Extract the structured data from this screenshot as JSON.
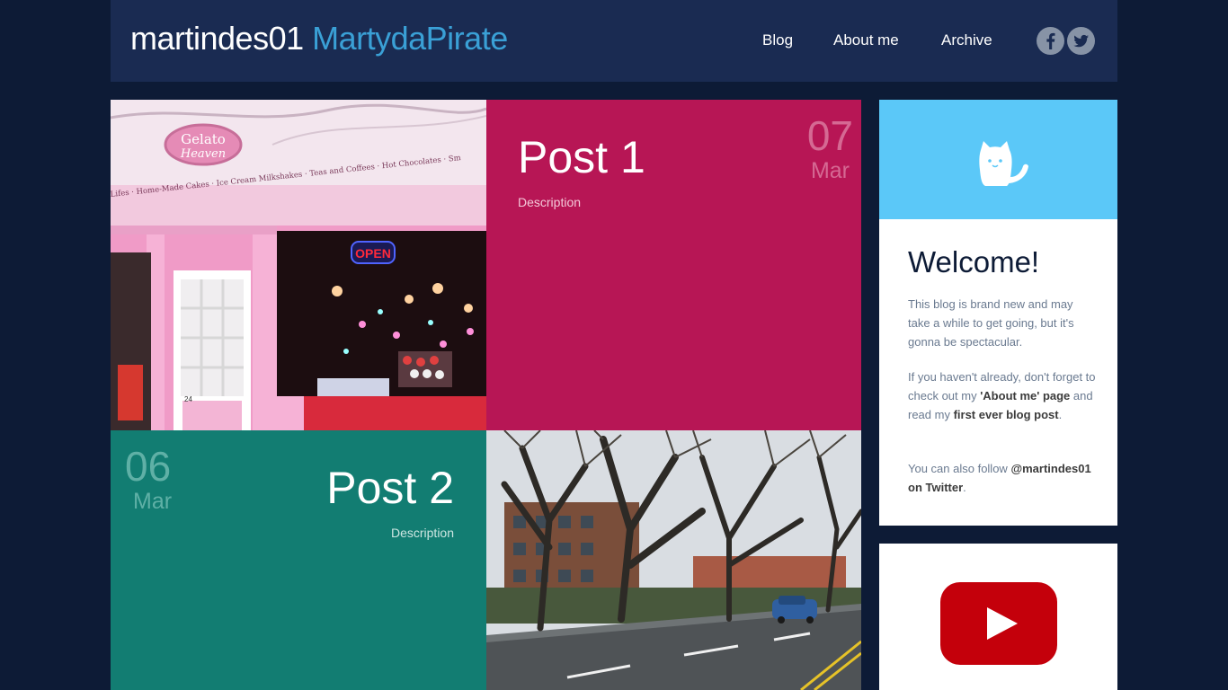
{
  "header": {
    "username": "martindes01",
    "alias": "MartydaPirate",
    "nav": [
      {
        "label": "Blog"
      },
      {
        "label": "About me"
      },
      {
        "label": "Archive"
      }
    ],
    "social": [
      {
        "icon": "facebook-icon"
      },
      {
        "icon": "twitter-icon"
      }
    ]
  },
  "posts": [
    {
      "title": "Post 1",
      "description": "Description",
      "day": "07",
      "month": "Mar",
      "color": "#b71655"
    },
    {
      "title": "Post 2",
      "description": "Description",
      "day": "06",
      "month": "Mar",
      "color": "#127d72"
    }
  ],
  "photos": [
    {
      "sign_name": "Gelato",
      "sign_name2": "Heaven",
      "sign_text": "Lifes · Home-Made Cakes · Ice Cream Milkshakes · Teas and Coffees · Hot Chocolates · Sm",
      "open_sign": "OPEN",
      "door_number": "24"
    },
    {}
  ],
  "sidebar": {
    "mascot_icon": "cat-icon",
    "accent": "#5bc8f8",
    "welcome": {
      "title": "Welcome!",
      "p1": "This blog is brand new and may take a while to get going, but it's gonna be spectacular.",
      "p2_pre": "If you haven't already, don't forget to check out my ",
      "p2_link1": "'About me' page",
      "p2_mid": " and read my ",
      "p2_link2": "first ever blog post",
      "p2_post": ".",
      "p3_pre": "You can also follow ",
      "p3_link": "@martindes01 on Twitter",
      "p3_post": "."
    },
    "video_icon": "youtube-icon"
  }
}
